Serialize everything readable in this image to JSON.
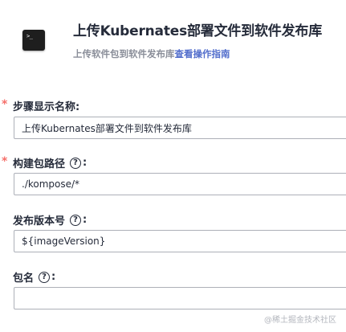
{
  "header": {
    "icon": "terminal-icon",
    "icon_text": ">_",
    "title": "上传Kubernates部署文件到软件发布库",
    "subtitle_prefix": "上传软件包到软件发布库",
    "subtitle_link": "查看操作指南"
  },
  "fields": [
    {
      "label": "步骤显示名称:",
      "required": true,
      "help": false,
      "value": "上传Kubernates部署文件到软件发布库"
    },
    {
      "label": "构建包路径",
      "required": true,
      "help": true,
      "value": "./kompose/*"
    },
    {
      "label": "发布版本号",
      "required": false,
      "help": true,
      "value": "${imageVersion}"
    },
    {
      "label": "包名",
      "required": false,
      "help": true,
      "value": ""
    }
  ],
  "required_mark": "*",
  "help_glyph": "?",
  "colon": ":",
  "watermark": "@稀土掘金技术社区",
  "colors": {
    "required": "#f66f6a",
    "link": "#526ecc",
    "border": "#adb0b8"
  }
}
